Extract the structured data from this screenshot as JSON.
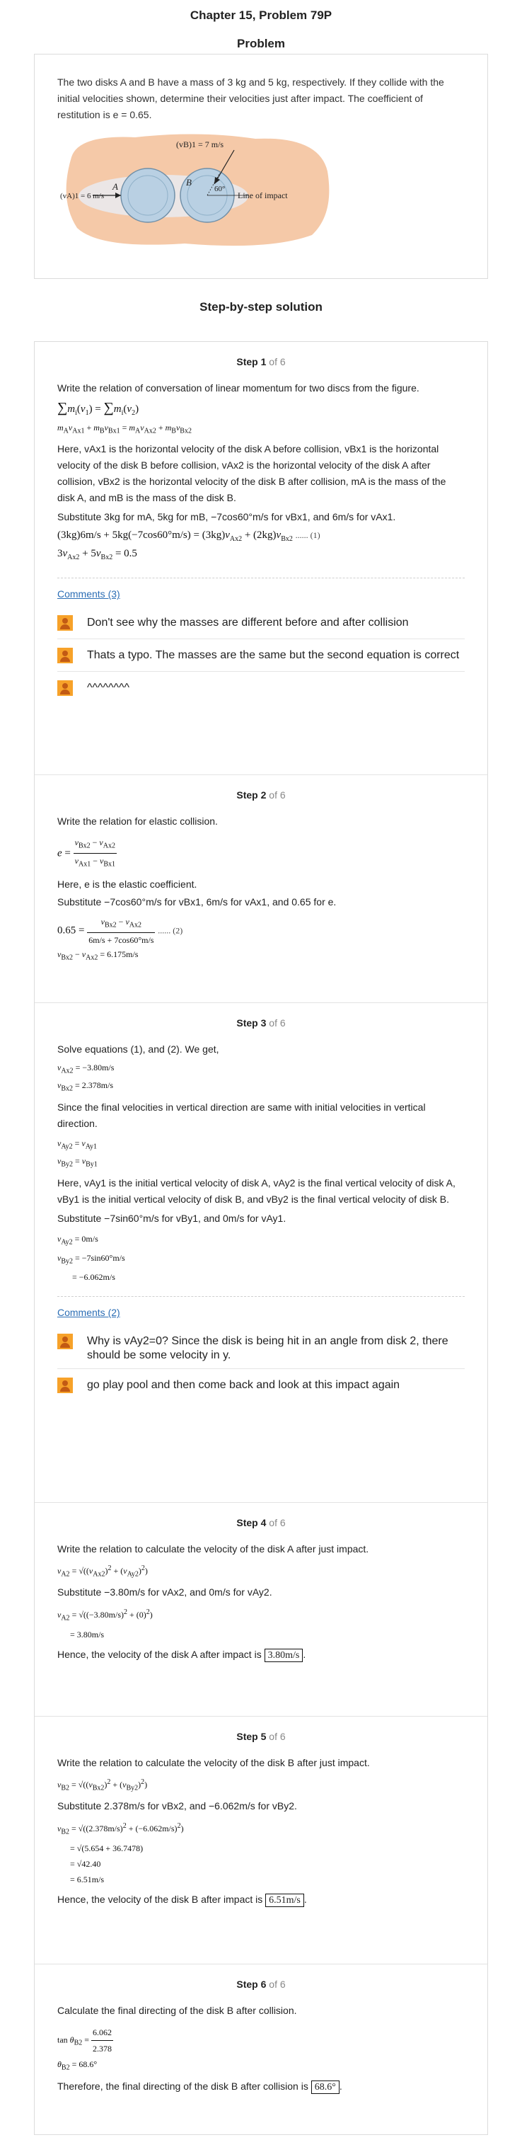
{
  "chapter_title": "Chapter 15, Problem 79P",
  "problem_heading": "Problem",
  "problem_text": "The two disks A and B have a mass of 3 kg and 5 kg, respectively. If they collide with the initial velocities shown, determine their velocities just after impact. The coefficient of restitution is e = 0.65.",
  "figure": {
    "vB_label": "(vB)1 = 7 m/s",
    "vA_label": "(vA)1 = 6 m/s",
    "disk_a": "A",
    "disk_b": "B",
    "angle": "60°",
    "line_of_impact": "Line of impact"
  },
  "solution_heading": "Step-by-step solution",
  "step_label": "Step",
  "of_label": "of 6",
  "steps": [
    {
      "num": "1",
      "intro": "Write the relation of conversation of linear momentum for two discs from the figure.",
      "here": "Here, vAx1 is the horizontal velocity of the disk A before collision, vBx1 is the horizontal velocity of the disk B before collision, vAx2 is the horizontal velocity of the disk A after collision, vBx2 is the horizontal velocity of the disk B after collision, mA is the mass of the disk A, and mB is the mass of the disk B.",
      "substitute": "Substitute 3kg for mA, 5kg for mB, −7cos60°m/s for vBx1, and 6m/s for vAx1.",
      "eq_label": "...... (1)",
      "comments_link": "Comments (3)",
      "comments": [
        "Don't see why the masses are different before and after collision",
        "Thats a typo. The masses are the same but the second equation is correct",
        "^^^^^^^^"
      ]
    },
    {
      "num": "2",
      "intro": "Write the relation for elastic collision.",
      "here": "Here, e is the elastic coefficient.",
      "substitute": "Substitute −7cos60°m/s for vBx1, 6m/s for vAx1, and 0.65 for e.",
      "eq_label": "...... (2)"
    },
    {
      "num": "3",
      "intro": "Solve equations (1), and (2). We get,",
      "vertical": "Since the final velocities in vertical direction are same with initial velocities in vertical direction.",
      "here": "Here, vAy1 is the initial vertical velocity of disk A, vAy2 is the final vertical velocity of disk A, vBy1 is the initial vertical velocity of disk B, and vBy2 is the final vertical velocity of disk B.",
      "substitute": "Substitute −7sin60°m/s for vBy1, and 0m/s for vAy1.",
      "comments_link": "Comments (2)",
      "comments": [
        "Why is vAy2=0? Since the disk is being hit in an angle from disk 2, there should be some velocity in y.",
        "go play pool and then come back and look at this impact again"
      ]
    },
    {
      "num": "4",
      "intro": "Write the relation to calculate the velocity of the disk A after just impact.",
      "substitute": "Substitute −3.80m/s for vAx2, and 0m/s for vAy2.",
      "conclusion": "Hence, the velocity of the disk A after impact is",
      "answer": "3.80m/s"
    },
    {
      "num": "5",
      "intro": "Write the relation to calculate the velocity of the disk B after just impact.",
      "substitute": "Substitute 2.378m/s for vBx2, and −6.062m/s for vBy2.",
      "conclusion": "Hence, the velocity of the disk B after impact is",
      "answer": "6.51m/s"
    },
    {
      "num": "6",
      "intro": "Calculate the final directing of the disk B after collision.",
      "conclusion": "Therefore, the final directing of the disk B after collision is",
      "answer": "68.6°"
    }
  ],
  "colors": {
    "figure_background": "#f5c9a8",
    "disk_fill": "#b9d0e3",
    "link": "#2c6eb5",
    "avatar": "#f7a22a"
  }
}
